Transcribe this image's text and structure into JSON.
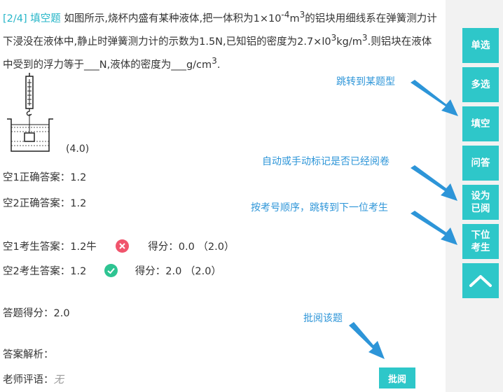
{
  "question": {
    "index": "[2/4]",
    "type": "填空题",
    "part1": "如图所示,烧杯内盛有某种液体,把一体积为1×10",
    "sup1": "-4",
    "part2": "m",
    "sup2": "3",
    "part3": "的铝块用细线系在弹簧测力计下浸没在液体中,静止时弹簧测力计的示数为1.5N,已知铝的密度为2.7×l0",
    "sup3": "3",
    "part4": "kg/m",
    "sup4": "3",
    "part5": ".则铝块在液体中受到的浮力等于",
    "blank": "___",
    "part6": "N,液体的密度为",
    "part7": "g/cm",
    "sup5": "3",
    "part8": ".",
    "score": "(4.0)"
  },
  "answers": {
    "blank1_correct_label": "空1正确答案：",
    "blank1_correct": "1.2",
    "blank2_correct_label": "空2正确答案：",
    "blank2_correct": "1.2",
    "blank1_student_label": "空1考生答案：",
    "blank1_student": "1.2牛",
    "blank2_student_label": "空2考生答案：",
    "blank2_student": "1.2",
    "score_label": "得分：",
    "blank1_score": "0.0",
    "blank1_full": "（2.0）",
    "blank2_score": "2.0",
    "blank2_full": "（2.0）",
    "total_label": "答题得分：",
    "total": "2.0",
    "analysis_label": "答案解析：",
    "comment_label": "老师评语：",
    "comment": "无"
  },
  "nav": {
    "single": "单选",
    "multi": "多选",
    "fill": "填空",
    "qa": "问答",
    "mark_line1": "设为",
    "mark_line2": "已阅",
    "next_line1": "下位",
    "next_line2": "考生"
  },
  "review_button": "批阅",
  "annotations": {
    "jump_type": "跳转到某题型",
    "mark_read": "自动或手动标记是否已经阅卷",
    "next_student": "按考号顺序，跳转到下一位考生",
    "review": "批阅该题"
  },
  "colors": {
    "accent": "#2ec7c9",
    "tag": "#27b6c8",
    "annotation": "#2d95d8",
    "wrong": "#f0546c",
    "right": "#2ec492"
  }
}
